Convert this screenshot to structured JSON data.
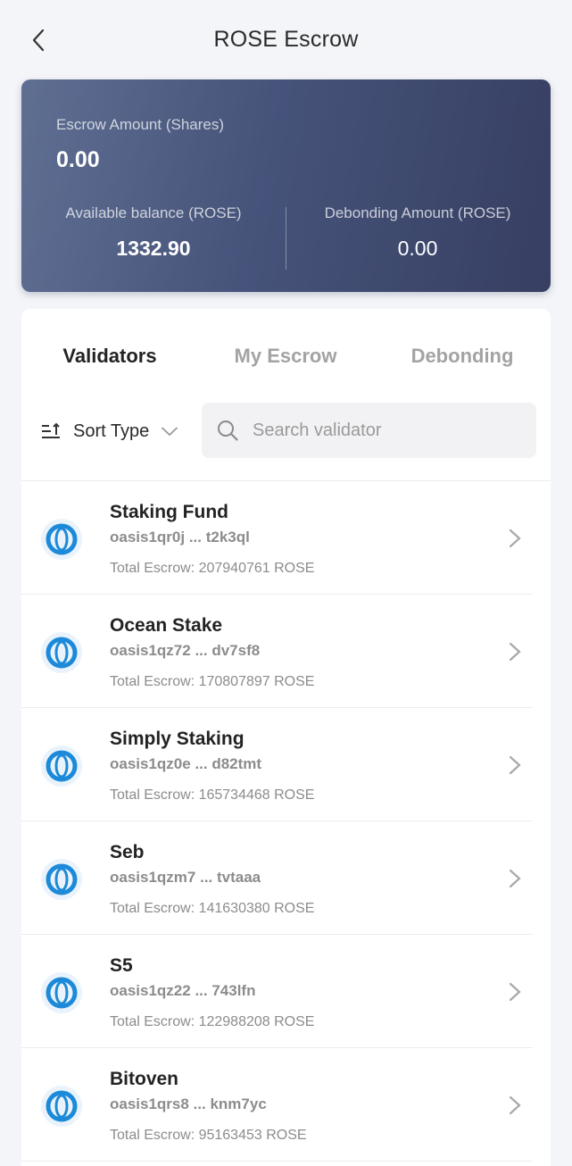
{
  "header": {
    "title": "ROSE Escrow",
    "back_icon": "chevron-left-icon"
  },
  "summary": {
    "escrow_label": "Escrow Amount (Shares)",
    "escrow_value": "0.00",
    "available_label": "Available balance (ROSE)",
    "available_value": "1332.90",
    "debonding_label": "Debonding Amount (ROSE)",
    "debonding_value": "0.00"
  },
  "tabs": [
    {
      "label": "Validators",
      "active": true
    },
    {
      "label": "My Escrow",
      "active": false
    },
    {
      "label": "Debonding",
      "active": false
    }
  ],
  "filters": {
    "sort_label": "Sort Type",
    "search_placeholder": "Search validator"
  },
  "validators": [
    {
      "name": "Staking Fund",
      "address": "oasis1qr0j ... t2k3ql",
      "escrow": "Total Escrow: 207940761 ROSE"
    },
    {
      "name": "Ocean Stake",
      "address": "oasis1qz72 ... dv7sf8",
      "escrow": "Total Escrow: 170807897 ROSE"
    },
    {
      "name": "Simply Staking",
      "address": "oasis1qz0e ... d82tmt",
      "escrow": "Total Escrow: 165734468 ROSE"
    },
    {
      "name": "Seb",
      "address": "oasis1qzm7 ... tvtaaa",
      "escrow": "Total Escrow: 141630380 ROSE"
    },
    {
      "name": "S5",
      "address": "oasis1qz22 ... 743lfn",
      "escrow": "Total Escrow: 122988208 ROSE"
    },
    {
      "name": "Bitoven",
      "address": "oasis1qrs8 ... knm7yc",
      "escrow": "Total Escrow: 95163453 ROSE"
    }
  ],
  "colors": {
    "card_gradient_start": "#5f6f92",
    "card_gradient_end": "#373f62",
    "logo_blue": "#1c8ad8",
    "active_tab": "#232323",
    "inactive_tab": "#a3a3a3"
  }
}
